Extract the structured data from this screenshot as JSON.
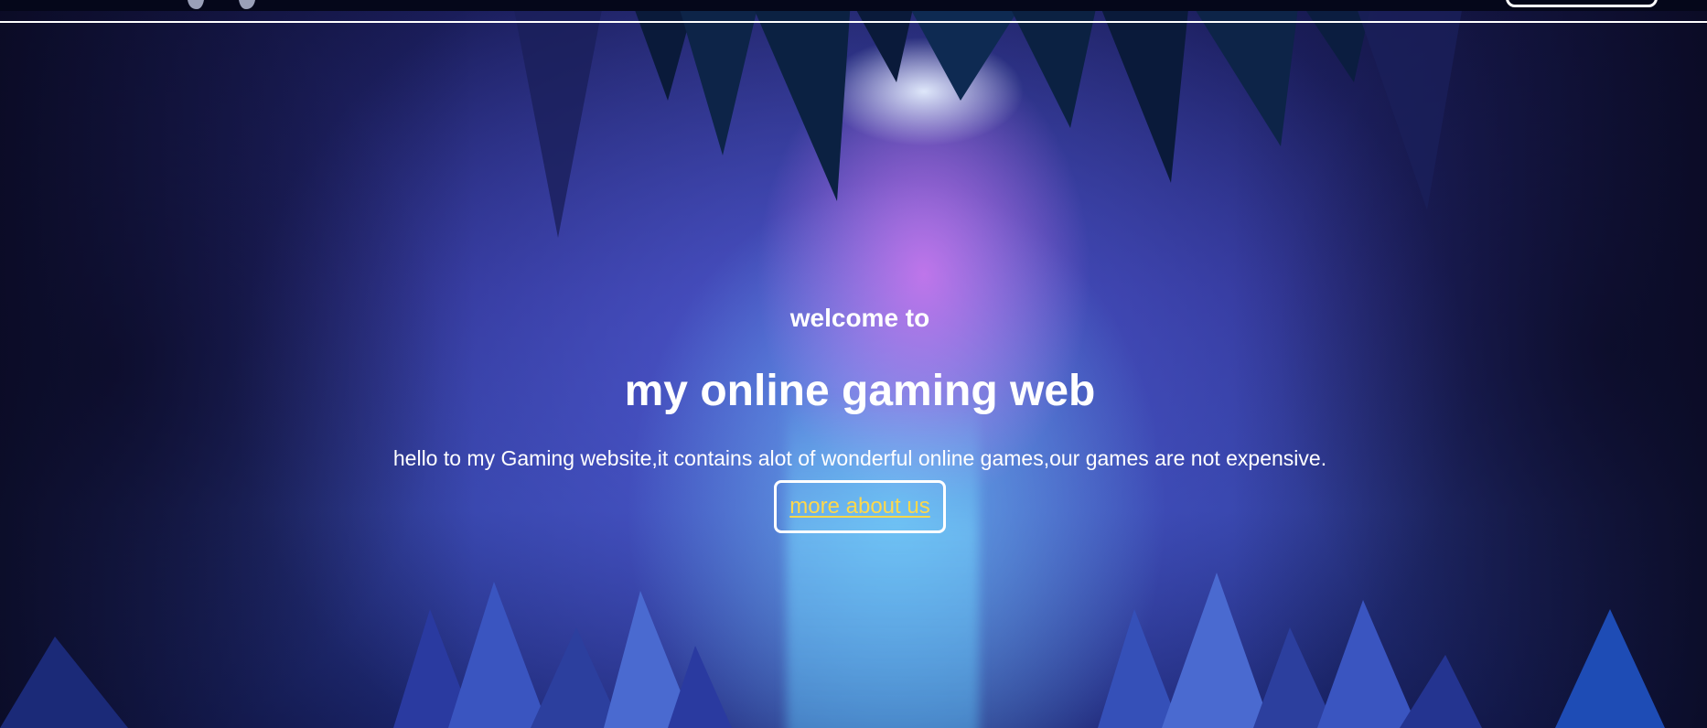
{
  "hero": {
    "welcome": "welcome to",
    "title": "my online gaming web",
    "intro": "hello to my Gaming website,it contains alot of wonderful online games,our games are not expensive.",
    "cta_label": "more about us"
  },
  "colors": {
    "text": "#ffffff",
    "link": "#ffd84a",
    "topbar": "#05071a",
    "button_border": "#ffffff"
  },
  "icons": {
    "logo": "gamepad-logo"
  }
}
